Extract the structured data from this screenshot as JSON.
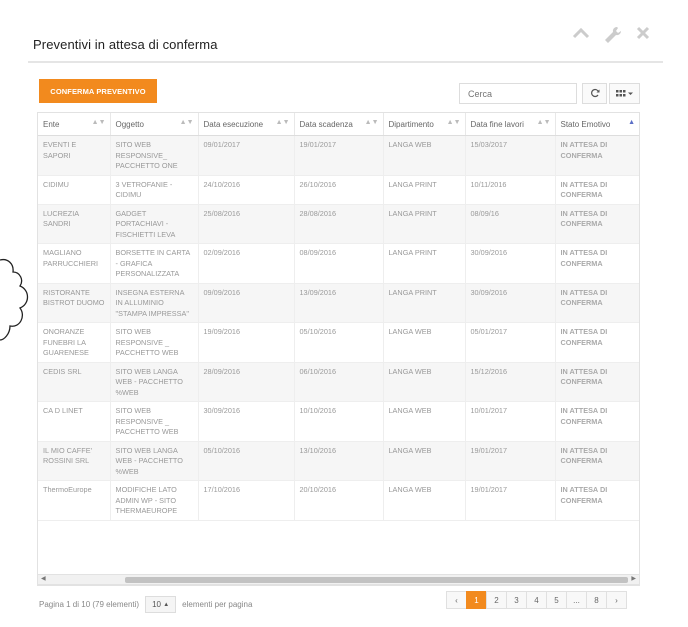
{
  "panel": {
    "title": "Preventivi in attesa di conferma",
    "icons": [
      "chevron-up-icon",
      "wrench-icon",
      "close-icon"
    ]
  },
  "toolbar": {
    "confirm_label": "CONFERMA PREVENTIVO",
    "search_placeholder": "Cerca"
  },
  "table": {
    "columns": [
      "Ente",
      "Oggetto",
      "Data esecuzione",
      "Data scadenza",
      "Dipartimento",
      "Data fine lavori",
      "Stato Emotivo"
    ],
    "rows": [
      [
        "EVENTI E SAPORI",
        "SITO WEB RESPONSIVE_ PACCHETTO ONE",
        "09/01/2017",
        "19/01/2017",
        "LANGA WEB",
        "15/03/2017",
        "IN ATTESA DI CONFERMA"
      ],
      [
        "CIDIMU",
        "3 VETROFANIE - CIDIMU",
        "24/10/2016",
        "26/10/2016",
        "LANGA PRINT",
        "10/11/2016",
        "IN ATTESA DI CONFERMA"
      ],
      [
        "LUCREZIA SANDRI",
        "GADGET PORTACHIAVI - FISCHIETTI LEVA",
        "25/08/2016",
        "28/08/2016",
        "LANGA PRINT",
        "08/09/16",
        "IN ATTESA DI CONFERMA"
      ],
      [
        "MAGLIANO PARRUCCHIERI",
        "BORSETTE IN CARTA - GRAFICA PERSONALIZZATA",
        "02/09/2016",
        "08/09/2016",
        "LANGA PRINT",
        "30/09/2016",
        "IN ATTESA DI CONFERMA"
      ],
      [
        "RISTORANTE BISTROT DUOMO",
        "INSEGNA ESTERNA IN ALLUMINIO \"STAMPA IMPRESSA\"",
        "09/09/2016",
        "13/09/2016",
        "LANGA PRINT",
        "30/09/2016",
        "IN ATTESA DI CONFERMA"
      ],
      [
        "ONORANZE FUNEBRI LA GUARENESE",
        "SITO WEB RESPONSIVE _ PACCHETTO WEB",
        "19/09/2016",
        "05/10/2016",
        "LANGA WEB",
        "05/01/2017",
        "IN ATTESA DI CONFERMA"
      ],
      [
        "CEDIS Srl",
        "SITO WEB LANGA WEB - PACCHETTO %WEB",
        "28/09/2016",
        "06/10/2016",
        "LANGA WEB",
        "15/12/2016",
        "IN ATTESA DI CONFERMA"
      ],
      [
        "CA D LINET",
        "SITO WEB RESPONSIVE _ PACCHETTO WEB",
        "30/09/2016",
        "10/10/2016",
        "LANGA WEB",
        "10/01/2017",
        "IN ATTESA DI CONFERMA"
      ],
      [
        "IL MIO CAFFE' ROSSINI SRL",
        "SITO WEB LANGA WEB - PACCHETTO %WEB",
        "05/10/2016",
        "13/10/2016",
        "LANGA WEB",
        "19/01/2017",
        "IN ATTESA DI CONFERMA"
      ],
      [
        "ThermoEurope",
        "MODIFICHE LATO ADMIN WP - SITO THERMAEUROPE",
        "17/10/2016",
        "20/10/2016",
        "LANGA WEB",
        "19/01/2017",
        "IN ATTESA DI CONFERMA"
      ]
    ]
  },
  "footer": {
    "info": "Pagina 1 di 10 (79 elementi)",
    "page_size": "10",
    "page_size_suffix": "elementi per pagina",
    "pages": [
      "‹",
      "1",
      "2",
      "3",
      "4",
      "5",
      "...",
      "8",
      "›"
    ],
    "active_page": "1"
  },
  "colors": {
    "accent": "#f28a1e",
    "sort_active": "#5b6fc7"
  }
}
